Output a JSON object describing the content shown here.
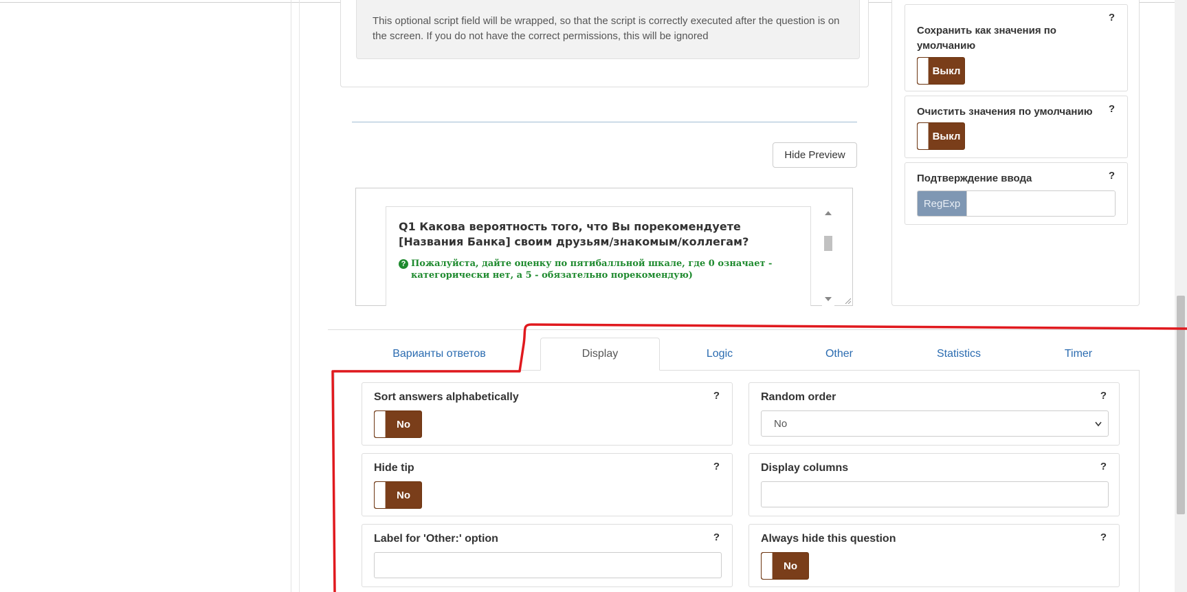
{
  "script_help": {
    "text": "This optional script field will be wrapped, so that the script is correctly executed after the question is on the screen. If you do not have the correct permissions, this will be ignored"
  },
  "preview": {
    "hide_button": "Hide Preview",
    "question_title": "Q1 Какова вероятность того, что Вы порекомендуете [Названия Банка] своим друзьям/знакомым/коллегам?",
    "tip_text": "Пожалуйста, дайте оценку по пятибалльной шкале, где 0 означает - категорически нет, а 5 - обязательно порекомендую)"
  },
  "right_settings": {
    "save_defaults": {
      "label": "Сохранить как значения по умолчанию",
      "help": "?",
      "toggle": "Выкл"
    },
    "clear_defaults": {
      "label": "Очистить значения по умолчанию",
      "help": "?",
      "toggle": "Выкл"
    },
    "input_validation": {
      "label": "Подтверждение ввода",
      "help": "?",
      "addon": "RegExp",
      "value": ""
    }
  },
  "tabs": [
    {
      "label": "Варианты ответов",
      "active": false
    },
    {
      "label": "Display",
      "active": true
    },
    {
      "label": "Logic",
      "active": false
    },
    {
      "label": "Other",
      "active": false
    },
    {
      "label": "Statistics",
      "active": false
    },
    {
      "label": "Timer",
      "active": false
    }
  ],
  "display_fields": {
    "sort_alpha": {
      "label": "Sort answers alphabetically",
      "help": "?",
      "toggle": "No"
    },
    "random_order": {
      "label": "Random order",
      "help": "?",
      "selected": "No"
    },
    "hide_tip": {
      "label": "Hide tip",
      "help": "?",
      "toggle": "No"
    },
    "display_columns": {
      "label": "Display columns",
      "help": "?",
      "value": ""
    },
    "other_label": {
      "label": "Label for 'Other:' option",
      "help": "?",
      "value": ""
    },
    "always_hide": {
      "label": "Always hide this question",
      "help": "?",
      "toggle": "No"
    }
  },
  "colors": {
    "toggle_bg": "#7a3e1a",
    "tab_link": "#2a6bb0",
    "tip_green": "#1e8a2e",
    "regexp_addon": "#7f97b3",
    "annotation_red": "#e0191e"
  },
  "icons": {
    "tip": "question-circle-icon",
    "select": "chevron-down-icon"
  }
}
